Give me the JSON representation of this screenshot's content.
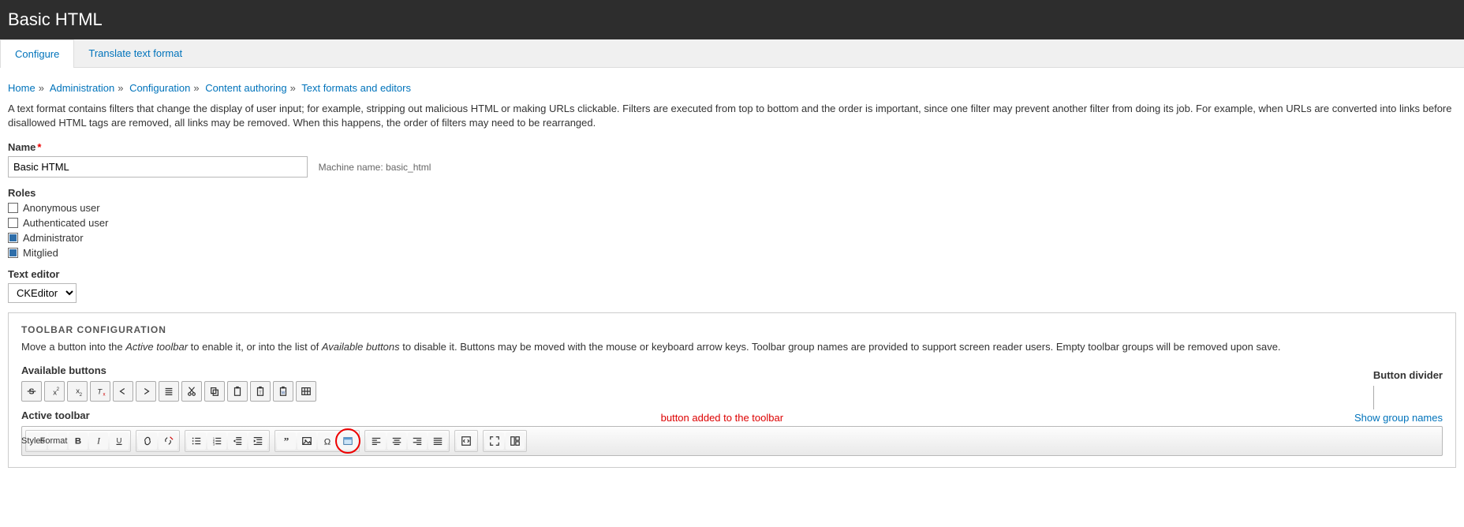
{
  "header": {
    "title": "Basic HTML"
  },
  "tabs": {
    "configure": "Configure",
    "translate": "Translate text format"
  },
  "breadcrumb": {
    "home": "Home",
    "admin": "Administration",
    "config": "Configuration",
    "authoring": "Content authoring",
    "editors": "Text formats and editors"
  },
  "description": "A text format contains filters that change the display of user input; for example, stripping out malicious HTML or making URLs clickable. Filters are executed from top to bottom and the order is important, since one filter may prevent another filter from doing its job. For example, when URLs are converted into links before disallowed HTML tags are removed, all links may be removed. When this happens, the order of filters may need to be rearranged.",
  "name": {
    "label": "Name",
    "value": "Basic HTML",
    "machine_label": "Machine name:",
    "machine_value": "basic_html"
  },
  "roles": {
    "label": "Roles",
    "items": [
      {
        "label": "Anonymous user",
        "checked": false
      },
      {
        "label": "Authenticated user",
        "checked": false
      },
      {
        "label": "Administrator",
        "checked": true
      },
      {
        "label": "Mitglied",
        "checked": true
      }
    ]
  },
  "text_editor": {
    "label": "Text editor",
    "value": "CKEditor"
  },
  "toolbar": {
    "title": "TOOLBAR CONFIGURATION",
    "desc_pre": "Move a button into the ",
    "desc_em1": "Active toolbar",
    "desc_mid": " to enable it, or into the list of ",
    "desc_em2": "Available buttons",
    "desc_post": " to disable it. Buttons may be moved with the mouse or keyboard arrow keys. Toolbar group names are provided to support screen reader users. Empty toolbar groups will be removed upon save.",
    "available_label": "Available buttons",
    "divider_label": "Button divider",
    "active_label": "Active toolbar",
    "annotation": "button added to the toolbar",
    "show_link": "Show group names",
    "available_buttons": [
      "strike",
      "superscript",
      "subscript",
      "remove-format",
      "undo",
      "redo",
      "justify-center",
      "cut",
      "copy",
      "paste",
      "paste-text",
      "paste-word",
      "table"
    ],
    "style_dropdown": "Styles",
    "format_dropdown": "Format",
    "active_groups": [
      [
        "bold",
        "italic",
        "underline"
      ],
      [
        "link",
        "unlink"
      ],
      [
        "bulleted-list",
        "numbered-list",
        "outdent",
        "indent"
      ],
      [
        "blockquote",
        "image",
        "omega",
        "iframe"
      ],
      [
        "align-left",
        "align-center",
        "align-right",
        "align-justify"
      ],
      [
        "source"
      ],
      [
        "maximize",
        "show-blocks"
      ]
    ]
  }
}
